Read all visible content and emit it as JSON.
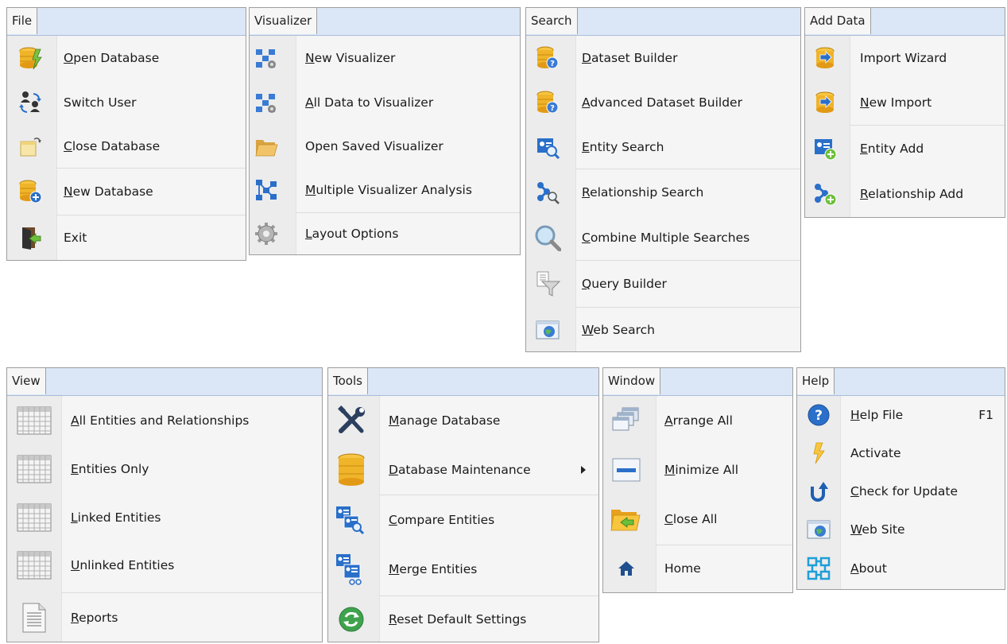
{
  "file": {
    "title": "File",
    "items": [
      "Open Database",
      "Switch User",
      "Close Database",
      "New Database",
      "Exit"
    ]
  },
  "visualizer": {
    "title": "Visualizer",
    "items": [
      "New Visualizer",
      "All Data to Visualizer",
      "Open Saved Visualizer",
      "Multiple Visualizer Analysis",
      "Layout Options"
    ]
  },
  "search": {
    "title": "Search",
    "items": [
      "Dataset Builder",
      "Advanced Dataset Builder",
      "Entity Search",
      "Relationship Search",
      "Combine Multiple Searches",
      "Query Builder",
      "Web Search"
    ]
  },
  "add_data": {
    "title": "Add Data",
    "items": [
      "Import Wizard",
      "New Import",
      "Entity Add",
      "Relationship Add"
    ]
  },
  "view": {
    "title": "View",
    "items": [
      "All Entities and Relationships",
      "Entities Only",
      "Linked Entities",
      "Unlinked Entities",
      "Reports"
    ]
  },
  "tools": {
    "title": "Tools",
    "items": [
      "Manage Database",
      "Database Maintenance",
      "Compare Entities",
      "Merge Entities",
      "Reset Default Settings"
    ]
  },
  "window": {
    "title": "Window",
    "items": [
      "Arrange All",
      "Minimize All",
      "Close All",
      "Home"
    ]
  },
  "help": {
    "title": "Help",
    "items": [
      "Help File",
      "Activate",
      "Check for Update",
      "Web Site",
      "About"
    ],
    "shortcut": "F1"
  },
  "icons": {
    "file": [
      "database-lightning-icon",
      "switch-user-icon",
      "close-folder-icon",
      "new-database-icon",
      "exit-door-icon"
    ],
    "visualizer": [
      "visualizer-network-icon",
      "visualizer-network-icon",
      "folder-icon",
      "multi-visualizer-icon",
      "gear-icon"
    ],
    "search": [
      "database-question-icon",
      "database-question-icon",
      "entity-search-icon",
      "relationship-search-icon",
      "magnifier-icon",
      "funnel-icon",
      "web-icon"
    ],
    "add_data": [
      "import-icon",
      "import-icon",
      "entity-add-icon",
      "relationship-add-icon"
    ],
    "view": [
      "grid-icon",
      "grid-icon",
      "grid-icon",
      "grid-icon",
      "report-icon"
    ],
    "tools": [
      "tools-icon",
      "database-icon",
      "compare-entities-icon",
      "merge-entities-icon",
      "reset-icon"
    ],
    "window": [
      "cascade-windows-icon",
      "minimize-window-icon",
      "folder-arrow-icon",
      "home-icon"
    ],
    "help": [
      "help-icon",
      "lightning-icon",
      "update-arrow-icon",
      "web-icon",
      "about-icon"
    ]
  },
  "colors": {
    "header": "#dbe7f7",
    "menu_bg": "#f5f5f5",
    "border": "#9e9e9e",
    "accent_blue": "#2a6fc9",
    "gold": "#e8a11c"
  }
}
